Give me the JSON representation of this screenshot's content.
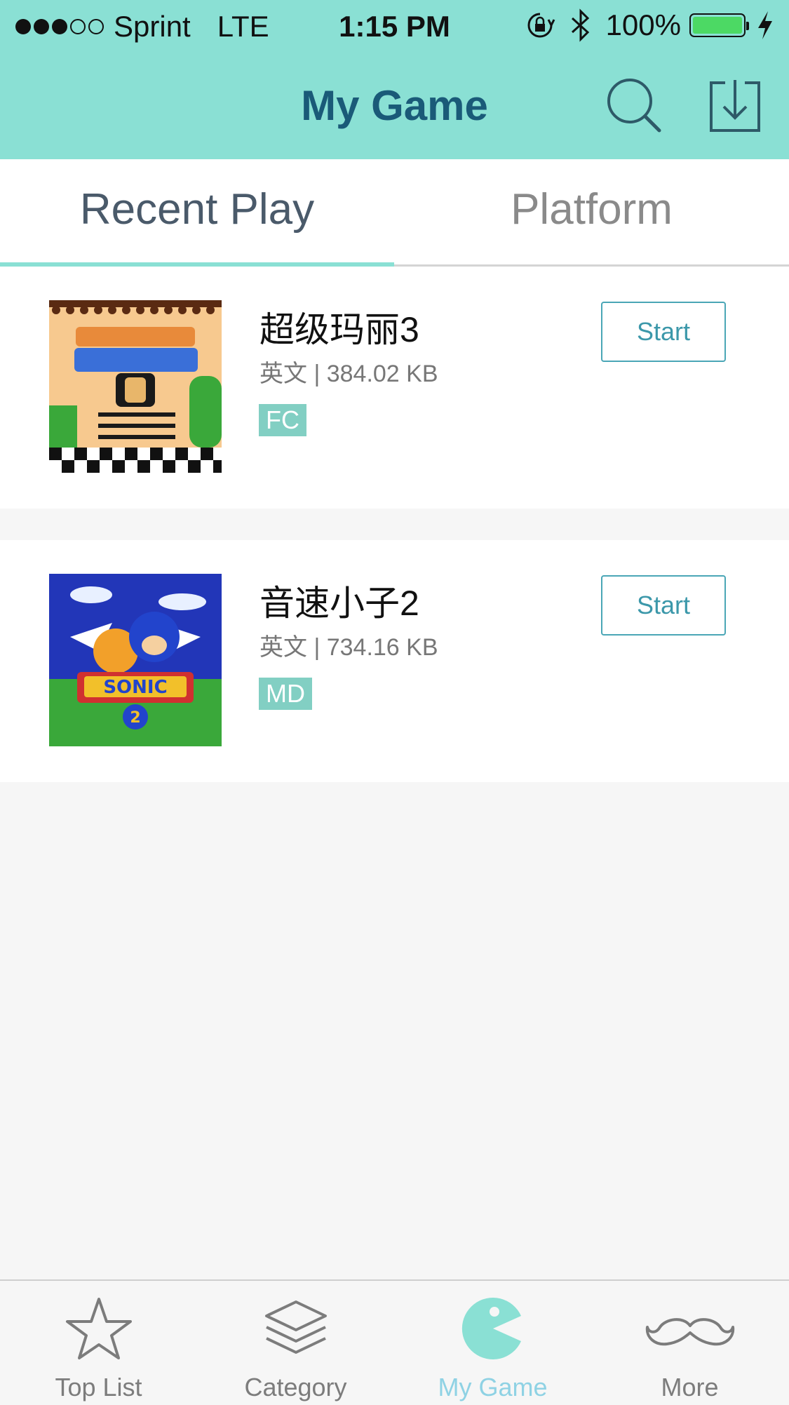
{
  "status_bar": {
    "carrier": "Sprint",
    "network": "LTE",
    "time": "1:15 PM",
    "battery": "100%",
    "signal_bars_filled": 3,
    "signal_bars_total": 5
  },
  "nav": {
    "title": "My Game",
    "icons": [
      "search-icon",
      "download-icon"
    ]
  },
  "tabs": [
    {
      "label": "Recent Play",
      "active": true
    },
    {
      "label": "Platform",
      "active": false
    }
  ],
  "games": [
    {
      "title": "超级玛丽3",
      "meta": "英文 | 384.02 KB",
      "platform": "FC",
      "start_label": "Start"
    },
    {
      "title": "音速小子2",
      "meta": "英文 | 734.16 KB",
      "platform": "MD",
      "start_label": "Start"
    }
  ],
  "tab_bar": [
    {
      "label": "Top List",
      "icon": "star-icon",
      "active": false
    },
    {
      "label": "Category",
      "icon": "layers-icon",
      "active": false
    },
    {
      "label": "My Game",
      "icon": "pacman-icon",
      "active": true
    },
    {
      "label": "More",
      "icon": "mustache-icon",
      "active": false
    }
  ],
  "colors": {
    "accent": "#8ae0d4",
    "title": "#1a5a78",
    "active_tab": "#8fd2e4",
    "tag": "#82cfc3",
    "start_border": "#4aa6b6"
  }
}
